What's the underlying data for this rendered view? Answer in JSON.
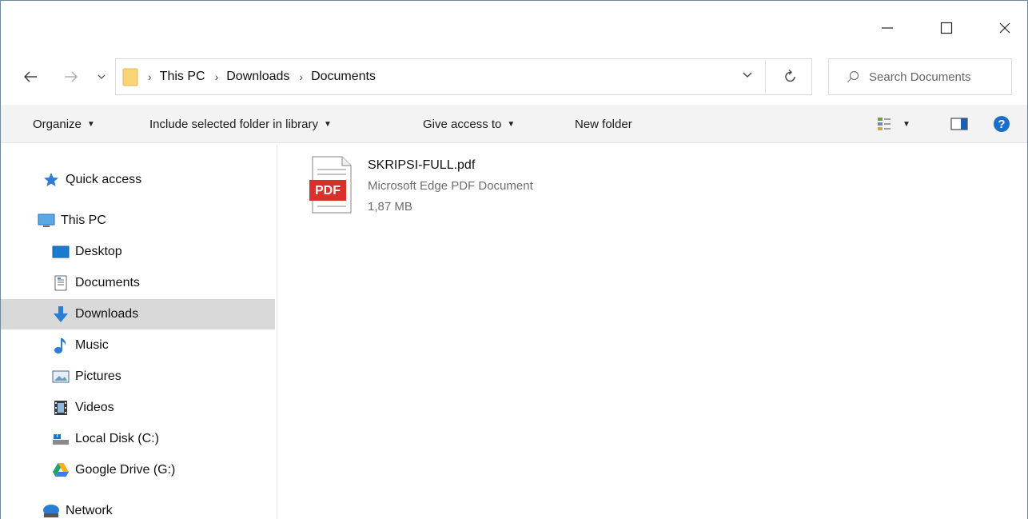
{
  "window": {
    "controls": {
      "minimize": "—",
      "maximize": "☐",
      "close": "✕"
    }
  },
  "address": {
    "breadcrumbs": [
      "This PC",
      "Downloads",
      "Documents"
    ],
    "search_placeholder": "Search Documents"
  },
  "toolbar": {
    "organize": "Organize",
    "include_library": "Include selected folder in library",
    "give_access": "Give access to",
    "new_folder": "New folder"
  },
  "sidebar": {
    "items": [
      {
        "label": "Quick access",
        "icon": "star-icon"
      },
      {
        "label": "This PC",
        "icon": "monitor-icon"
      },
      {
        "label": "Desktop",
        "icon": "desktop-icon"
      },
      {
        "label": "Documents",
        "icon": "documents-icon"
      },
      {
        "label": "Downloads",
        "icon": "download-arrow-icon",
        "selected": true
      },
      {
        "label": "Music",
        "icon": "music-note-icon"
      },
      {
        "label": "Pictures",
        "icon": "pictures-icon"
      },
      {
        "label": "Videos",
        "icon": "film-icon"
      },
      {
        "label": "Local Disk (C:)",
        "icon": "hard-disk-icon"
      },
      {
        "label": "Google Drive (G:)",
        "icon": "google-drive-icon"
      },
      {
        "label": "Network",
        "icon": "network-icon"
      }
    ]
  },
  "files": [
    {
      "name": "SKRIPSI-FULL.pdf",
      "type": "Microsoft Edge PDF Document",
      "size": "1,87 MB",
      "badge": "PDF"
    }
  ],
  "colors": {
    "selected_bg": "#d9d9d9",
    "toolbar_bg": "#f3f3f3",
    "accent_blue": "#1a73c8",
    "pdf_red": "#d9302c"
  }
}
